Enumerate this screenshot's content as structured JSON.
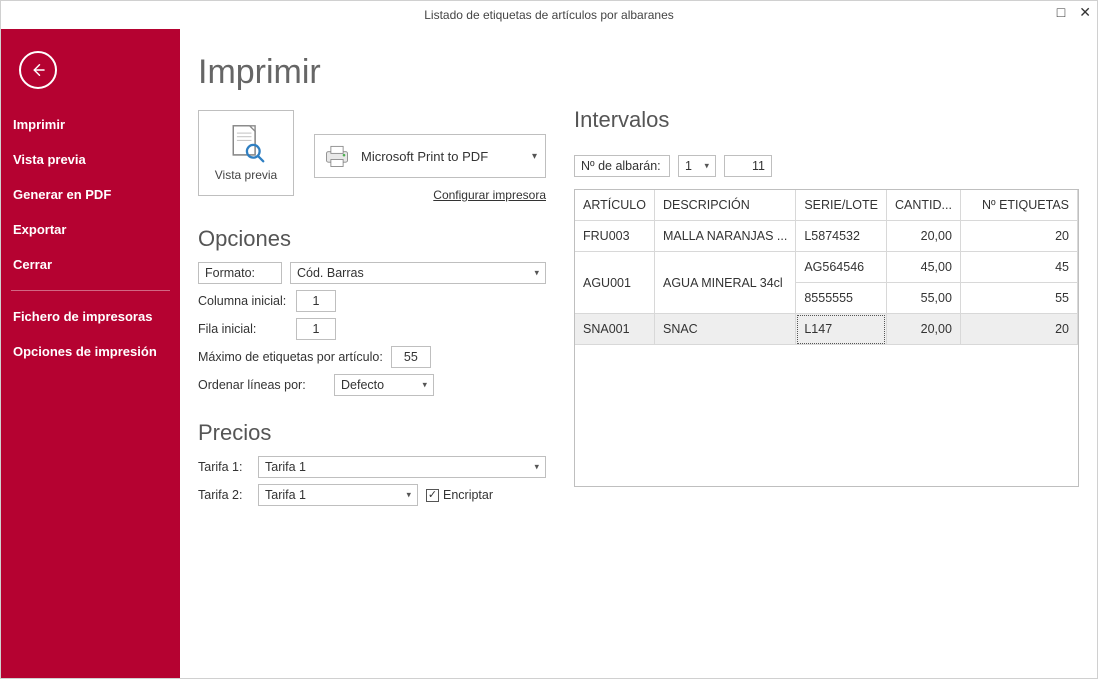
{
  "window": {
    "title": "Listado de etiquetas de artículos por albaranes"
  },
  "sidebar": {
    "items": [
      {
        "label": "Imprimir"
      },
      {
        "label": "Vista previa"
      },
      {
        "label": "Generar en PDF"
      },
      {
        "label": "Exportar"
      },
      {
        "label": "Cerrar"
      }
    ],
    "lower": [
      {
        "label": "Fichero de impresoras"
      },
      {
        "label": "Opciones de impresión"
      }
    ]
  },
  "page": {
    "title": "Imprimir",
    "preview_label": "Vista previa",
    "printer_name": "Microsoft Print to PDF",
    "configure_printer": "Configurar impresora"
  },
  "opciones": {
    "title": "Opciones",
    "formato_label": "Formato:",
    "formato_value": "Cód. Barras",
    "col_inicial_label": "Columna inicial:",
    "col_inicial_value": "1",
    "fila_inicial_label": "Fila inicial:",
    "fila_inicial_value": "1",
    "max_etq_label": "Máximo de etiquetas por artículo:",
    "max_etq_value": "55",
    "ordenar_label": "Ordenar líneas por:",
    "ordenar_value": "Defecto"
  },
  "precios": {
    "title": "Precios",
    "tarifa1_label": "Tarifa 1:",
    "tarifa1_value": "Tarifa 1",
    "tarifa2_label": "Tarifa 2:",
    "tarifa2_value": "Tarifa 1",
    "encriptar_label": "Encriptar",
    "encriptar_checked": true
  },
  "intervalos": {
    "title": "Intervalos",
    "n_albaran_label": "Nº de albarán:",
    "from": "1",
    "to": "11",
    "headers": {
      "articulo": "ARTÍCULO",
      "descripcion": "DESCRIPCIÓN",
      "serie": "SERIE/LOTE",
      "cantidad": "CANTID...",
      "n_etiquetas": "Nº ETIQUETAS"
    },
    "rows": [
      {
        "art": "FRU003",
        "desc": "MALLA NARANJAS ...",
        "serie": "L5874532",
        "cant": "20,00",
        "etq": "20",
        "rowspan": 1
      },
      {
        "art": "AGU001",
        "desc": "AGUA MINERAL 34cl",
        "serie": "AG564546",
        "cant": "45,00",
        "etq": "45",
        "rowspan": 2
      },
      {
        "art": "",
        "desc": "",
        "serie": "8555555",
        "cant": "55,00",
        "etq": "55",
        "skip": true
      },
      {
        "art": "SNA001",
        "desc": "SNAC",
        "serie": "L147",
        "cant": "20,00",
        "etq": "20",
        "rowspan": 1,
        "selected": true
      }
    ]
  }
}
